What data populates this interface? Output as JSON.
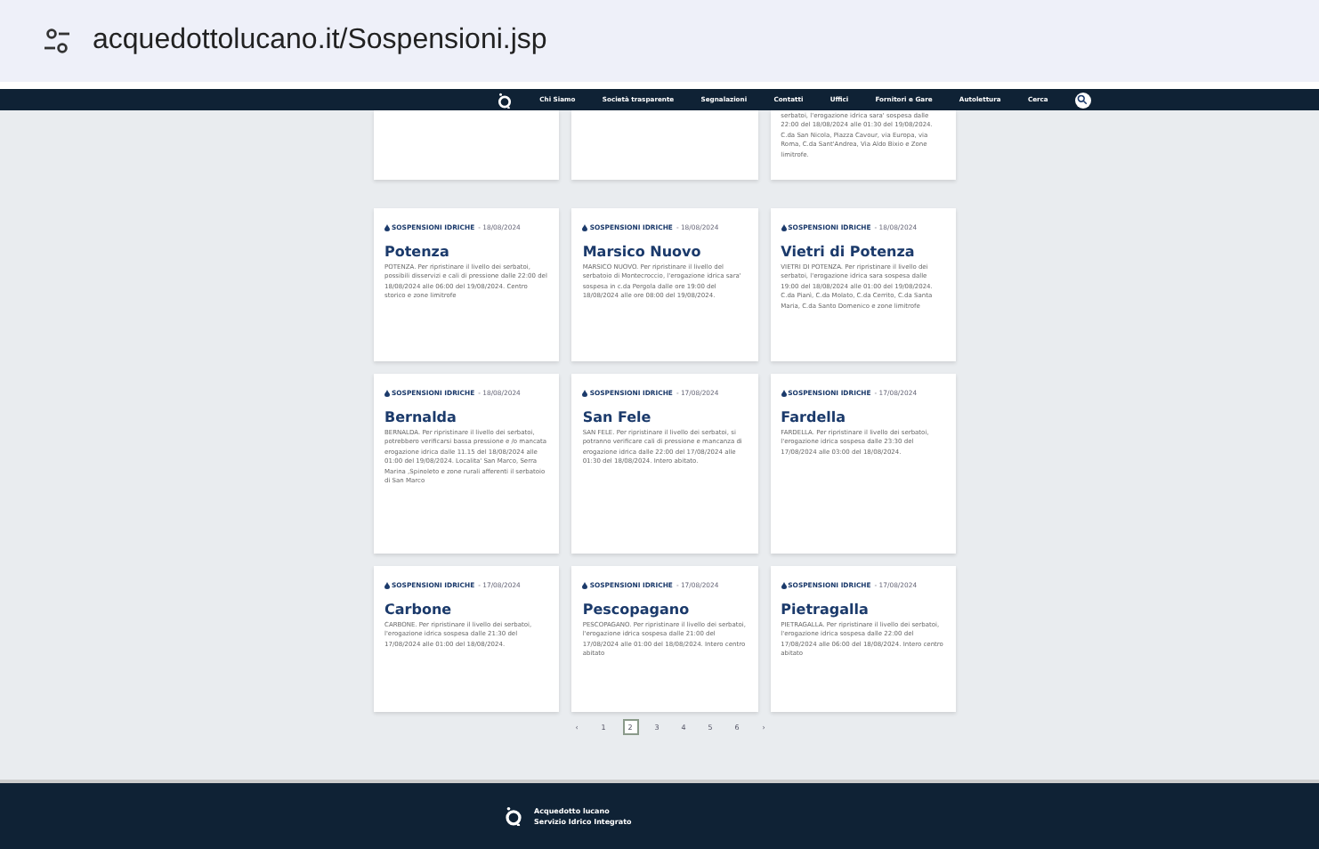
{
  "browser": {
    "url": "acquedottolucano.it/Sospensioni.jsp"
  },
  "nav": {
    "items": [
      "Chi Siamo",
      "Società trasparente",
      "Segnalazioni",
      "Contatti",
      "Uffici",
      "Fornitori e Gare",
      "Autolettura",
      "Cerca"
    ]
  },
  "top_row": [
    {
      "kind": "blank"
    },
    {
      "kind": "blank"
    },
    {
      "kind": "text",
      "description": "serbatoi, l'erogazione idrica sara' sospesa dalle 22:00 del 18/08/2024 alle 01:30 del 19/08/2024. C.da San Nicola, Piazza Cavour, via Europa, via Roma, C.da Sant'Andrea, Via Aldo Bixio e Zone limitrofe."
    }
  ],
  "cards": [
    {
      "category": "SOSPENSIONI IDRICHE",
      "date": "- 18/08/2024",
      "title": "Potenza",
      "description": "POTENZA. Per ripristinare il livello dei serbatoi, possibili disservizi e cali di pressione dalle 22:00 del 18/08/2024 alle 06:00 del 19/08/2024. Centro storico e zone limitrofe"
    },
    {
      "category": "SOSPENSIONI IDRICHE",
      "date": "- 18/08/2024",
      "title": "Marsico Nuovo",
      "description": "MARSICO NUOVO. Per ripristinare il livello del serbatoio di Montecroccio, l'erogazione idrica sara' sospesa in c.da Pergola dalle ore 19:00 del 18/08/2024 alle ore 08:00 del 19/08/2024."
    },
    {
      "category": "SOSPENSIONI IDRICHE",
      "date": "- 18/08/2024",
      "title": "Vietri di Potenza",
      "description": "VIETRI DI POTENZA. Per ripristinare il livello dei serbatoi, l'erogazione idrica sara sospesa dalle 19:00 del 18/08/2024 alle 01:00 del 19/08/2024. C.da Pianì, C.da Molato, C.da Cerrito, C.da Santa Maria, C.da Santo Domenico e zone limitrofe"
    },
    {
      "category": "SOSPENSIONI IDRICHE",
      "date": "- 18/08/2024",
      "title": "Bernalda",
      "description": "BERNALDA. Per ripristinare il livello dei serbatoi, potrebbero verificarsi bassa pressione e /o mancata erogazione idrica dalle 11.15 del 18/08/2024 alle 01:00 del 19/08/2024. Localita' San Marco, Serra Marina ,Spinoleto e zone rurali afferenti il serbatoio di San Marco"
    },
    {
      "category": "SOSPENSIONI IDRICHE",
      "date": "- 17/08/2024",
      "title": "San Fele",
      "description": "SAN FELE. Per ripristinare il livello dei serbatoi, si potranno verificare cali di pressione e mancanza di erogazione idrica dalle 22:00 del 17/08/2024 alle 01:30 del 18/08/2024. Intero abitato."
    },
    {
      "category": "SOSPENSIONI IDRICHE",
      "date": "- 17/08/2024",
      "title": "Fardella",
      "description": "FARDELLA. Per ripristinare il livello dei serbatoi, l'erogazione idrica sospesa dalle 23:30 del 17/08/2024 alle 03:00 del 18/08/2024."
    },
    {
      "category": "SOSPENSIONI IDRICHE",
      "date": "- 17/08/2024",
      "title": "Carbone",
      "description": "CARBONE. Per ripristinare il livello dei serbatoi, l'erogazione idrica sospesa dalle 21:30 del 17/08/2024 alle 01:00 del 18/08/2024."
    },
    {
      "category": "SOSPENSIONI IDRICHE",
      "date": "- 17/08/2024",
      "title": "Pescopagano",
      "description": "PESCOPAGANO. Per ripristinare il livello dei serbatoi, l'erogazione idrica sospesa dalle 21:00 del 17/08/2024 alle 01:00 del 18/08/2024. Intero centro abitato"
    },
    {
      "category": "SOSPENSIONI IDRICHE",
      "date": "- 17/08/2024",
      "title": "Pietragalla",
      "description": "PIETRAGALLA. Per ripristinare il livello dei serbatoi, l'erogazione idrica sospesa dalle 22:00 del 17/08/2024 alle 06:00 del 18/08/2024. Intero centro abitato"
    }
  ],
  "pagination": [
    {
      "label": "‹",
      "selected": false
    },
    {
      "label": "1",
      "selected": false
    },
    {
      "label": "2",
      "selected": true
    },
    {
      "label": "3",
      "selected": false
    },
    {
      "label": "4",
      "selected": false
    },
    {
      "label": "5",
      "selected": false
    },
    {
      "label": "6",
      "selected": false
    },
    {
      "label": "›",
      "selected": false
    }
  ],
  "footer": {
    "name": "Acquedotto lucano",
    "tagline": "Servizio Idrico Integrato"
  }
}
